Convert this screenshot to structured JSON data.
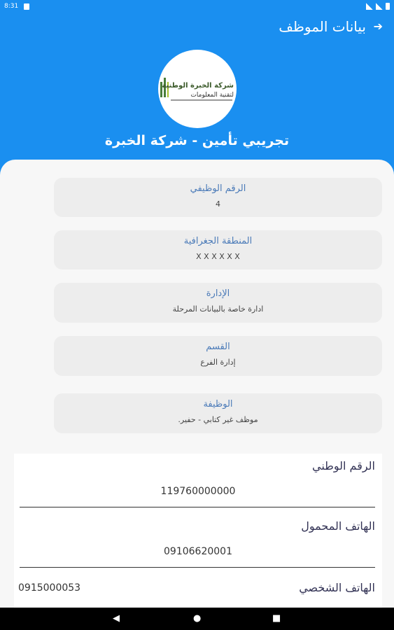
{
  "status": {
    "time": "8:31"
  },
  "header": {
    "back_icon": "arrow-right-icon",
    "title": "بيانات الموظف",
    "company_name": "تجريبي تأمين - شركة الخبرة",
    "logo_text_line1": "شركة الخبرة الوطنية",
    "logo_text_line2": "لتقنية المعلومات"
  },
  "cards": [
    {
      "label": "الرقم الوظيفي",
      "value": "4"
    },
    {
      "label": "المنطقة الجغرافية",
      "value": "X X X X X X"
    },
    {
      "label": "الإدارة",
      "value": "ادارة خاصة بالبيانات المرحلة"
    },
    {
      "label": "القسم",
      "value": "إدارة الفرع"
    },
    {
      "label": "الوظيفة",
      "value": "موظف غير كتابي - حفير."
    }
  ],
  "details": {
    "national_id_label": "الرقم الوطني",
    "national_id_value": "119760000000",
    "mobile_label": "الهاتف المحمول",
    "mobile_value": "09106620001",
    "personal_phone_label": "الهاتف الشخصي",
    "personal_phone_value": "0915000053"
  },
  "colors": {
    "primary": "#1a8ff0",
    "card_bg": "#ededed",
    "label": "#4a7ab8"
  }
}
